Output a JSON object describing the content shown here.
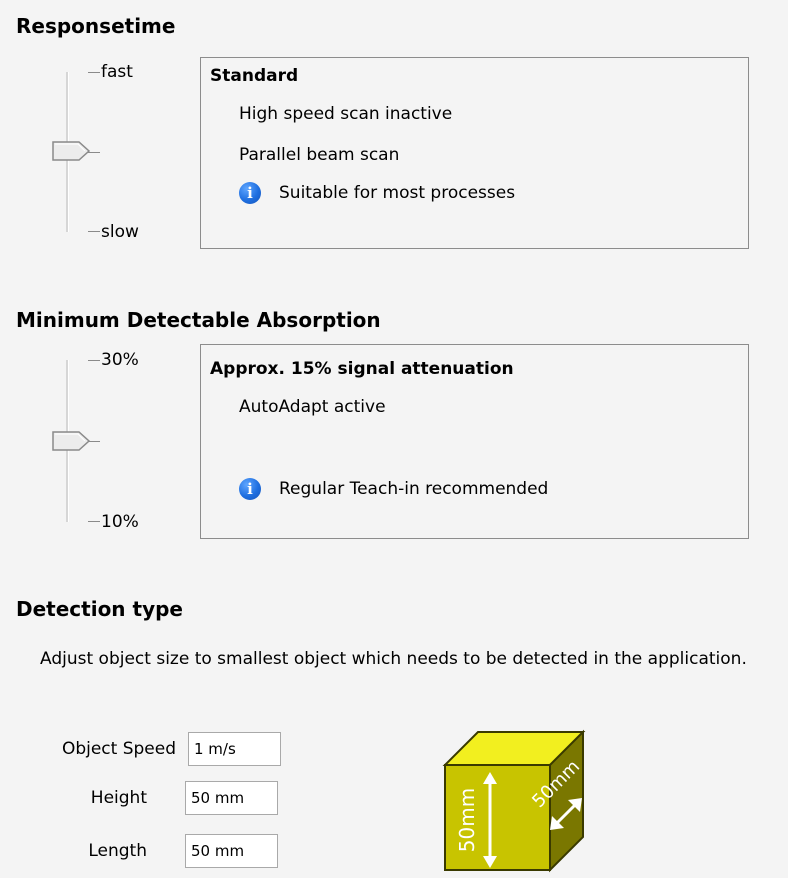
{
  "responsetime": {
    "title": "Responsetime",
    "slider": {
      "top_label": "fast",
      "bottom_label": "slow",
      "position": "middle"
    },
    "box": {
      "title": "Standard",
      "lines": [
        "High speed scan inactive",
        "Parallel beam scan"
      ],
      "info_text": "Suitable for most processes"
    }
  },
  "absorption": {
    "title": "Minimum Detectable Absorption",
    "slider": {
      "top_label": "30%",
      "bottom_label": "10%",
      "position": "middle"
    },
    "box": {
      "title": "Approx. 15% signal attenuation",
      "lines": [
        "AutoAdapt active"
      ],
      "info_text": "Regular Teach-in recommended"
    }
  },
  "detection": {
    "title": "Detection type",
    "description": "Adjust object size to smallest object which needs to be detected in the application.",
    "fields": [
      {
        "label": "Object Speed",
        "value": "1 m/s"
      },
      {
        "label": "Height",
        "value": "50 mm"
      },
      {
        "label": "Length",
        "value": "50 mm"
      }
    ],
    "cube": {
      "front_label": "50mm",
      "side_label": "50mm",
      "color": "#c8c400",
      "top_color": "#f2ef1f",
      "side_color": "#7a7700"
    }
  },
  "colors": {
    "info_icon": "#1f6fe0",
    "border": "#8c8c8c",
    "background": "#f4f4f4"
  },
  "icons": {
    "info": "info-icon",
    "slider_thumb": "slider-thumb"
  }
}
